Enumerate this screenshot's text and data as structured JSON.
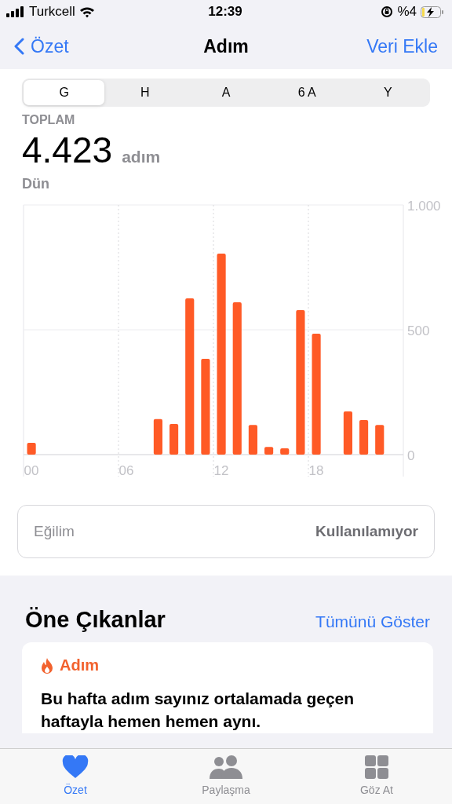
{
  "status_bar": {
    "carrier": "Turkcell",
    "time": "12:39",
    "battery": "%4"
  },
  "nav": {
    "back": "Özet",
    "title": "Adım",
    "action": "Veri Ekle"
  },
  "segments": [
    {
      "label": "G",
      "selected": true
    },
    {
      "label": "H",
      "selected": false
    },
    {
      "label": "A",
      "selected": false
    },
    {
      "label": "6 A",
      "selected": false
    },
    {
      "label": "Y",
      "selected": false
    }
  ],
  "summary": {
    "label": "TOPLAM",
    "value": "4.423",
    "unit": "adım",
    "date": "Dün"
  },
  "chart_data": {
    "type": "bar",
    "x": [
      0,
      8,
      9,
      10,
      11,
      12,
      13,
      14,
      15,
      16,
      17,
      18,
      20,
      21,
      22
    ],
    "xlim": [
      -0.5,
      23.5
    ],
    "series": [
      {
        "color": "#ff5a26",
        "values": [
          47,
          142,
          123,
          626,
          384,
          805,
          610,
          119,
          31,
          25,
          579,
          484,
          173,
          138,
          119
        ]
      }
    ],
    "ylim": [
      0,
      1000
    ],
    "yticks": [
      0,
      500,
      {
        "value": 1000,
        "label": "1.000"
      }
    ],
    "xticks": [
      {
        "value": 0,
        "label": "00"
      },
      {
        "value": 6,
        "label": "06"
      },
      {
        "value": 12,
        "label": "12"
      },
      {
        "value": 18,
        "label": "18"
      }
    ]
  },
  "trend": {
    "label": "Eğilim",
    "value": "Kullanılamıyor"
  },
  "highlights": {
    "title": "Öne Çıkanlar",
    "action": "Tümünü Göster",
    "card": {
      "category": "Adım",
      "text": "Bu hafta adım sayınız ortalamada geçen haftayla hemen hemen aynı."
    }
  },
  "tab_bar": [
    {
      "kind": "heart",
      "label": "Özet",
      "selected": true
    },
    {
      "kind": "people",
      "label": "Paylaşma",
      "selected": false
    },
    {
      "kind": "grid",
      "label": "Göz At",
      "selected": false
    }
  ]
}
